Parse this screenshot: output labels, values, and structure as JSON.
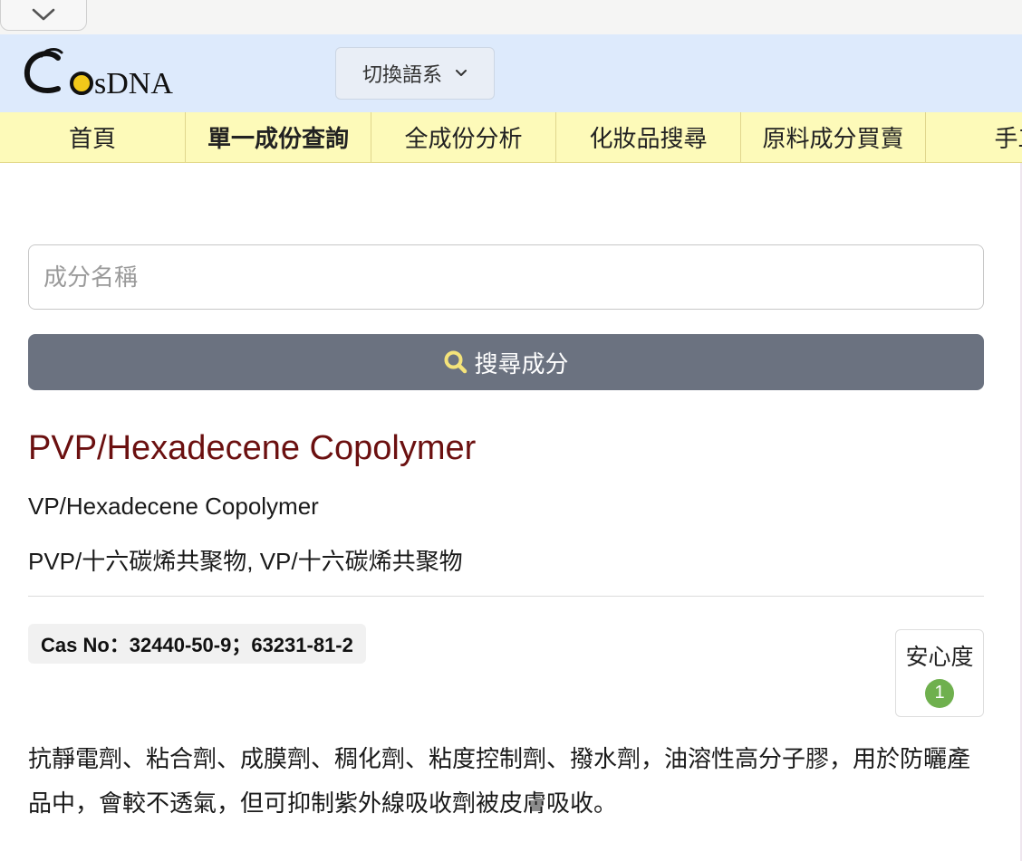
{
  "header": {
    "logo_text": "CosDNA",
    "language_label": "切換語系"
  },
  "nav": {
    "items": [
      {
        "label": "首頁"
      },
      {
        "label": "單一成份查詢"
      },
      {
        "label": "全成份分析"
      },
      {
        "label": "化妝品搜尋"
      },
      {
        "label": "原料成分買賣"
      },
      {
        "label": "手工"
      }
    ],
    "active_index": 1
  },
  "search": {
    "placeholder": "成分名稱",
    "value": "",
    "button_label": "搜尋成分"
  },
  "ingredient": {
    "name": "PVP/Hexadecene Copolymer",
    "alias_en": "VP/Hexadecene Copolymer",
    "alias_zh": "PVP/十六碳烯共聚物, VP/十六碳烯共聚物",
    "cas_no": "Cas No：32440-50-9；63231-81-2",
    "safety_label": "安心度",
    "safety_score": "1",
    "description": "抗靜電劑、粘合劑、成膜劑、稠化劑、粘度控制劑、撥水劑，油溶性高分子膠，用於防曬產品中，會較不透氣，但可抑制紫外線吸收劑被皮膚吸收。"
  },
  "colors": {
    "header_bg": "#ddeafc",
    "nav_bg": "#fdfab9",
    "title": "#6b1010",
    "search_button": "#6b7280",
    "search_icon": "#f4e37a",
    "safety_badge": "#6fb04e"
  }
}
